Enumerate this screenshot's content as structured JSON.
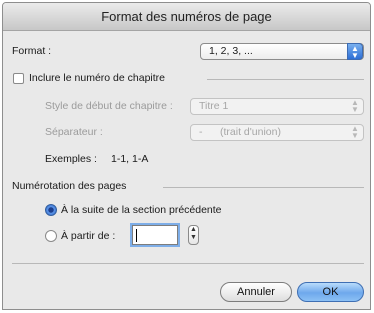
{
  "dialog": {
    "title": "Format des numéros de page"
  },
  "format": {
    "label": "Format :",
    "value": "1, 2, 3, ..."
  },
  "chapter": {
    "include_label": "Inclure le numéro de chapitre",
    "style_label": "Style de début de chapitre :",
    "style_value": "Titre 1",
    "separator_label": "Séparateur :",
    "separator_value": "-      (trait d'union)",
    "examples_label": "Exemples :",
    "examples_value": "1-1, 1-A"
  },
  "numbering": {
    "section_label": "Numérotation des pages",
    "continue_label": "À la suite de la section précédente",
    "start_at_label": "À partir de :",
    "start_at_value": ""
  },
  "buttons": {
    "cancel": "Annuler",
    "ok": "OK"
  },
  "icons": {
    "popup_arrows": "up-down-chevron-icon",
    "stepper": "stepper-icon"
  }
}
